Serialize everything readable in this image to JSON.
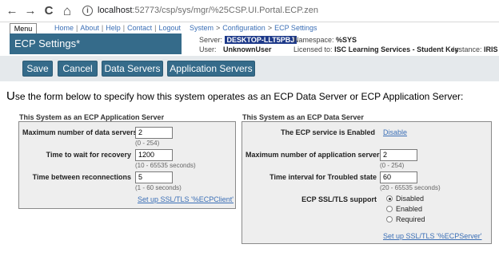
{
  "browser": {
    "back_icon": "←",
    "forward_icon": "→",
    "reload_icon": "C",
    "home_icon": "⌂",
    "info_icon": "i",
    "url_host": "localhost",
    "url_path": ":52773/csp/sys/mgr/%25CSP.UI.Portal.ECP.zen"
  },
  "header": {
    "menu_label": "Menu",
    "page_title": "ECP Settings*",
    "links": [
      "Home",
      "About",
      "Help",
      "Contact",
      "Logout"
    ],
    "breadcrumb": [
      "System",
      "Configuration",
      "ECP Settings"
    ],
    "server_label": "Server:",
    "server_value": "DESKTOP-LLT5PBJ",
    "namespace_label": "Namespace:",
    "namespace_value": "%SYS",
    "user_label": "User:",
    "user_value": "UnknownUser",
    "licensed_label": "Licensed to:",
    "licensed_value": "ISC Learning Services - Student Key",
    "instance_label": "Instance:",
    "instance_value": "IRIS",
    "title_color": "#356b8a"
  },
  "toolbar": {
    "save": "Save",
    "cancel": "Cancel",
    "data_servers": "Data Servers",
    "app_servers": "Application Servers"
  },
  "intro": {
    "first_letter": "U",
    "rest": "se the form below to specify how this system operates as an ECP Data Server or ECP Application Server:"
  },
  "app_server": {
    "title": "This System as an ECP Application Server",
    "max_data_servers_label": "Maximum number of data servers",
    "max_data_servers_value": "2",
    "max_data_servers_hint": "(0 - 254)",
    "recovery_label": "Time to wait for recovery",
    "recovery_value": "1200",
    "recovery_hint": "(10 - 65535 seconds)",
    "reconnect_label": "Time between reconnections",
    "reconnect_value": "5",
    "reconnect_hint": "(1 - 60 seconds)",
    "ssl_link": "Set up SSL/TLS '%ECPClient'"
  },
  "data_server": {
    "title": "This System as an ECP Data Server",
    "service_label": "The ECP service is Enabled",
    "disable_link": "Disable",
    "max_app_servers_label": "Maximum number of application servers",
    "max_app_servers_value": "2",
    "max_app_servers_hint": "(0 - 254)",
    "troubled_label": "Time interval for Troubled state",
    "troubled_value": "60",
    "troubled_hint": "(20 - 65535 seconds)",
    "ssl_support_label": "ECP SSL/TLS support",
    "ssl_options": [
      "Disabled",
      "Enabled",
      "Required"
    ],
    "ssl_selected": "Disabled",
    "ssl_link": "Set up SSL/TLS '%ECPServer'"
  }
}
